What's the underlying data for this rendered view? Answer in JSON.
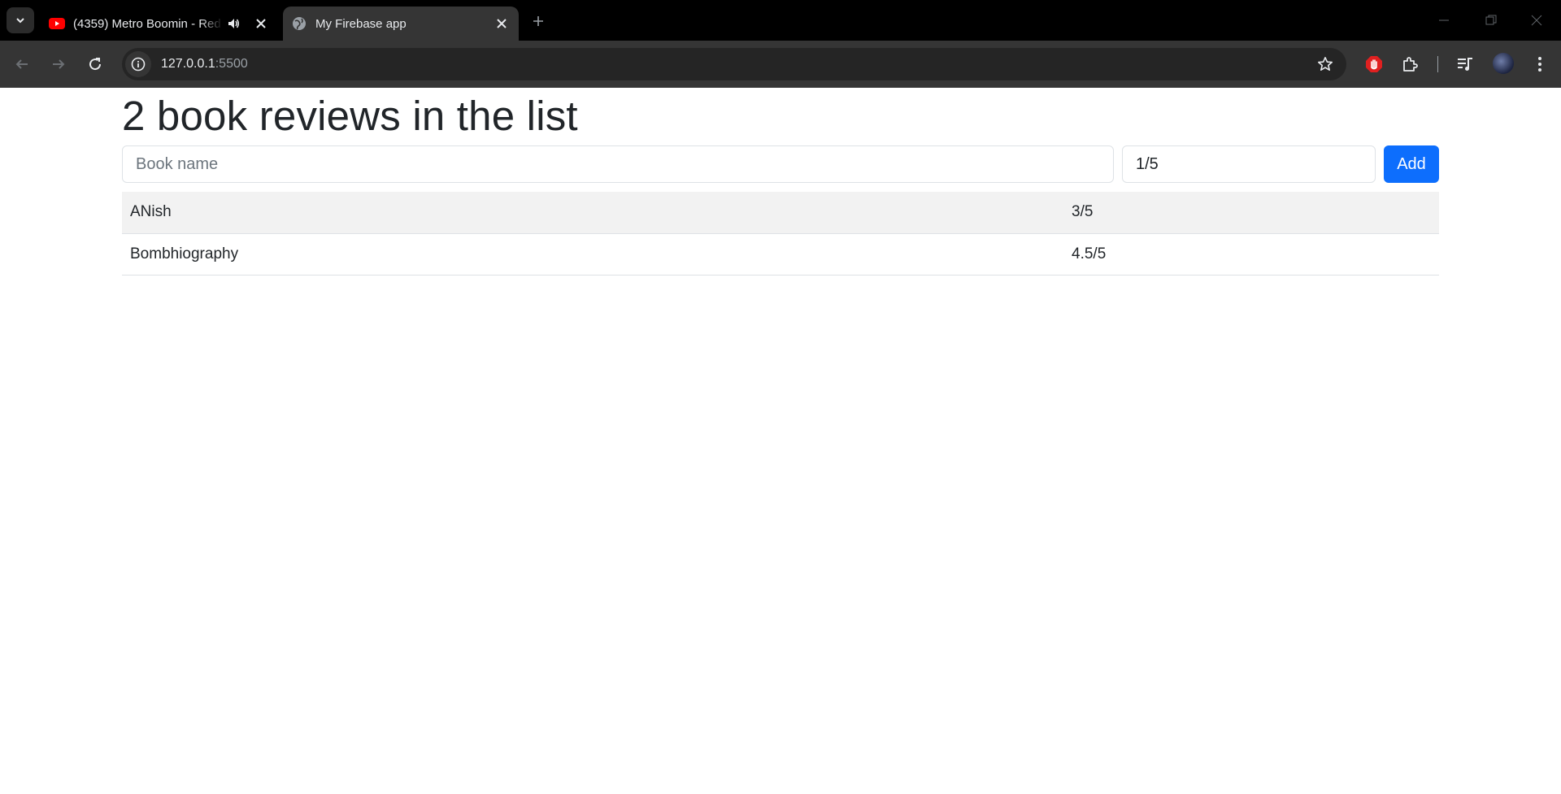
{
  "browser": {
    "tabs": [
      {
        "title": "(4359) Metro Boomin - Red",
        "active": false,
        "favicon": "youtube-icon",
        "audio": true
      },
      {
        "title": "My Firebase app",
        "active": true,
        "favicon": "globe-icon",
        "audio": false
      }
    ],
    "address": {
      "host": "127.0.0.1",
      "port": ":5500"
    }
  },
  "app": {
    "heading": "2 book reviews in the list",
    "form": {
      "book_placeholder": "Book name",
      "rating_value": "1/5",
      "add_label": "Add"
    },
    "reviews": [
      {
        "book": "ANish",
        "rating": "3/5"
      },
      {
        "book": "Bombhiography",
        "rating": "4.5/5"
      }
    ]
  },
  "colors": {
    "accent": "#0d6efd",
    "stripe": "#f2f2f2",
    "chrome_dark": "#000000",
    "toolbar": "#353535"
  }
}
